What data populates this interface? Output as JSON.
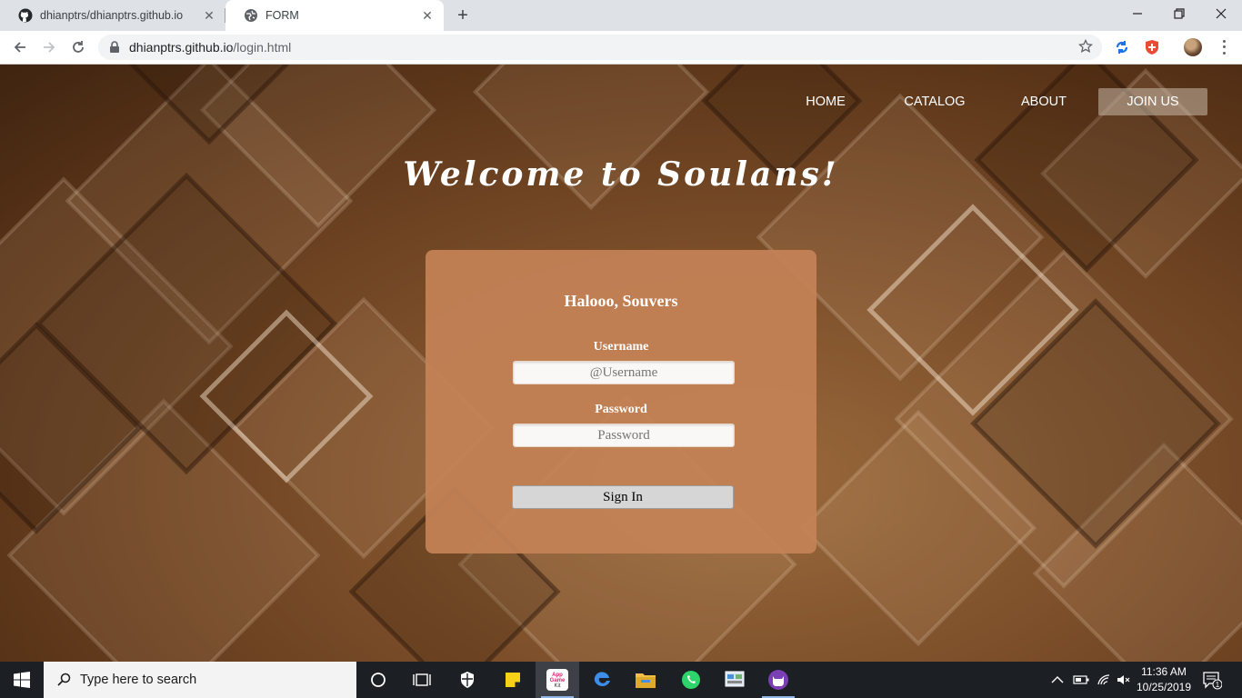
{
  "browser": {
    "tabs": [
      {
        "title": "dhianptrs/dhianptrs.github.io",
        "icon": "github-icon"
      },
      {
        "title": "FORM",
        "icon": "globe-icon"
      }
    ],
    "url_domain": "dhianptrs.github.io",
    "url_path": "/login.html"
  },
  "nav": {
    "items": [
      "HOME",
      "CATALOG",
      "ABOUT",
      "JOIN US"
    ],
    "active": "JOIN US"
  },
  "hero": {
    "title": "Welcome to Soulans!"
  },
  "login": {
    "greeting": "Halooo, Souvers",
    "username_label": "Username",
    "username_placeholder": "@Username",
    "password_label": "Password",
    "password_placeholder": "Password",
    "submit_label": "Sign In"
  },
  "taskbar": {
    "search_placeholder": "Type here to search",
    "time": "11:36 AM",
    "date": "10/25/2019",
    "notification_count": "1"
  },
  "colors": {
    "card": "#c48256",
    "page_bg": "#7a4d29",
    "active_nav": "#a89584"
  }
}
